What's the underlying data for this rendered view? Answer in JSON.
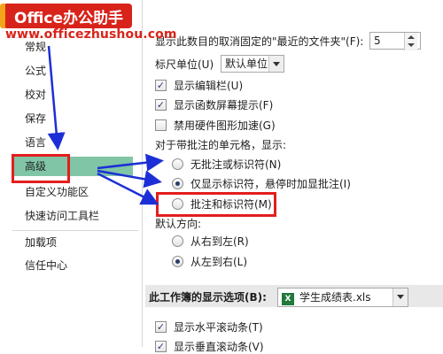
{
  "watermark": {
    "title": "Office办公助手",
    "url": "www.officezhushou.com"
  },
  "nav": {
    "items": [
      "常规",
      "公式",
      "校对",
      "保存",
      "语言",
      "高级",
      "自定义功能区",
      "快速访问工具栏",
      "加载项",
      "信任中心"
    ],
    "selected_index": 5
  },
  "options": {
    "recent_count_label": "显示此数目的取消固定的\"最近的文件夹\"(F):",
    "recent_count_value": "5",
    "ruler_label": "标尺单位(U)",
    "ruler_value": "默认单位",
    "show_formula_bar": "显示编辑栏(U)",
    "show_function_tips": "显示函数屏幕提示(F)",
    "disable_hw_accel": "禁用硬件图形加速(G)",
    "comments_heading": "对于带批注的单元格，显示:",
    "no_comments": "无批注或标识符(N)",
    "indicators_only": "仅显示标识符，悬停时加显批注(I)",
    "comments_and_indicators": "批注和标识符(M)",
    "direction_heading": "默认方向:",
    "right_to_left": "从右到左(R)",
    "left_to_right": "从左到右(L)",
    "workbook_section_label": "此工作簿的显示选项(B):",
    "workbook_name": "学生成绩表.xls",
    "show_hscroll": "显示水平滚动条(T)",
    "show_vscroll": "显示垂直滚动条(V)"
  },
  "state": {
    "show_formula_bar": true,
    "show_function_tips": true,
    "disable_hw_accel": false,
    "comments_choice": "indicators_only",
    "direction_choice": "left_to_right",
    "show_hscroll": true,
    "show_vscroll": true
  },
  "colors": {
    "selected_nav_bg": "#7fc5a6",
    "annotation_red": "#e31e1e",
    "arrow_blue": "#1c2fd6",
    "brand_red": "#d8231a"
  }
}
